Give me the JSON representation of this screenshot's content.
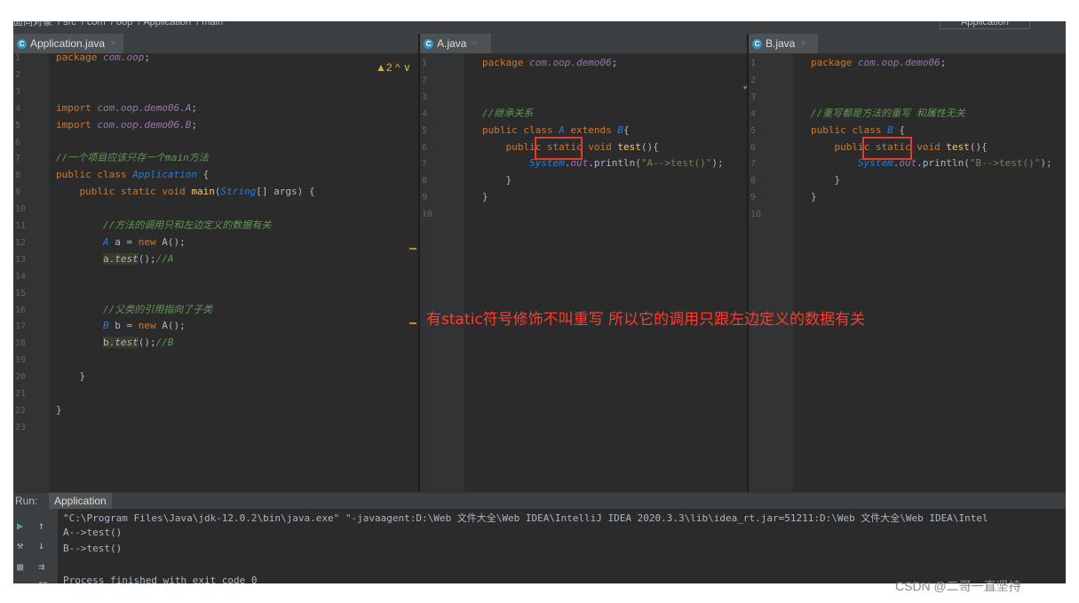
{
  "breadcrumbs": [
    "面向对象",
    "src",
    "com",
    "oop",
    "Application",
    "main"
  ],
  "run_config": "Application",
  "panes": {
    "application": {
      "tab": "Application.java",
      "warning": "▲2 ^ ∨",
      "lines": [
        {
          "n": "1",
          "html": "<span class='kw'>package </span><span class='pk'>com.oop</span>;"
        },
        {
          "n": "2",
          "html": ""
        },
        {
          "n": "3",
          "html": ""
        },
        {
          "n": "4",
          "html": "<span class='kw'>import </span><span class='pk'>com.oop.demo06.A</span>;"
        },
        {
          "n": "5",
          "html": "<span class='kw'>import </span><span class='pk'>com.oop.demo06.B</span>;"
        },
        {
          "n": "6",
          "html": ""
        },
        {
          "n": "7",
          "html": "<span class='cm'>//一个项目应该只存一个main方法</span>"
        },
        {
          "n": "8",
          "html": "<span class='kw'>public class </span><span class='cls'>Application</span> {"
        },
        {
          "n": "9",
          "html": "    <span class='kw'>public static void </span><span class='fn'>main</span>(<span class='cls'>String</span>[] args) {"
        },
        {
          "n": "10",
          "html": ""
        },
        {
          "n": "11",
          "html": "        <span class='cm'>//方法的调用只和左边定义的数据有关</span>"
        },
        {
          "n": "12",
          "html": "        <span class='cls'>A</span> a = <span class='kw'>new </span>A();"
        },
        {
          "n": "13",
          "html": "        <span class='hl'>a.<span class='it'>test</span></span>();<span class='cm'>//A</span>"
        },
        {
          "n": "14",
          "html": ""
        },
        {
          "n": "15",
          "html": ""
        },
        {
          "n": "16",
          "html": "        <span class='cm'>//父类的引用指向了子类</span>"
        },
        {
          "n": "17",
          "html": "        <span class='cls'>B</span> b = <span class='kw'>new </span>A();"
        },
        {
          "n": "18",
          "html": "        <span class='hl'>b.<span class='it'>test</span></span>();<span class='cm'>//B</span>"
        },
        {
          "n": "19",
          "html": ""
        },
        {
          "n": "20",
          "html": "    }"
        },
        {
          "n": "21",
          "html": ""
        },
        {
          "n": "22",
          "html": "}"
        },
        {
          "n": "23",
          "html": ""
        }
      ]
    },
    "a": {
      "tab": "A.java",
      "lines": [
        {
          "n": "1",
          "html": "<span class='kw'>package </span><span class='pk'>com.oop.demo06</span>;"
        },
        {
          "n": "2",
          "html": ""
        },
        {
          "n": "3",
          "html": ""
        },
        {
          "n": "4",
          "html": "<span class='cm'>//继承关系</span>"
        },
        {
          "n": "5",
          "html": "<span class='kw'>public class </span><span class='cls'>A </span><span class='kw'>extends </span><span class='cls'>B</span>{"
        },
        {
          "n": "6",
          "html": "    <span class='kw'>public static void </span><span class='fn'>test</span>(){"
        },
        {
          "n": "7",
          "html": "        <span class='cls'>System</span>.<span class='pk'>out</span>.println(<span class='str'>\"A-->test()\"</span>);"
        },
        {
          "n": "8",
          "html": "    }"
        },
        {
          "n": "9",
          "html": "}"
        },
        {
          "n": "10",
          "html": ""
        }
      ]
    },
    "b": {
      "tab": "B.java",
      "lines": [
        {
          "n": "1",
          "html": "<span class='kw'>package </span><span class='pk'>com.oop.demo06</span>;"
        },
        {
          "n": "2",
          "html": ""
        },
        {
          "n": "3",
          "html": ""
        },
        {
          "n": "4",
          "html": "<span class='cm'>//重写都是方法的重写 和属性无关</span>"
        },
        {
          "n": "5",
          "html": "<span class='kw'>public class </span><span class='cls'>B </span>{"
        },
        {
          "n": "6",
          "html": "    <span class='kw'>public static void </span><span class='fn'>test</span>(){"
        },
        {
          "n": "7",
          "html": "        <span class='cls'>System</span>.<span class='pk'>out</span>.println(<span class='str'>\"B-->test()\"</span>);"
        },
        {
          "n": "8",
          "html": "    }"
        },
        {
          "n": "9",
          "html": "}"
        },
        {
          "n": "10",
          "html": ""
        }
      ]
    }
  },
  "annotation": "有static符号修饰不叫重写  所以它的调用只跟左边定义的数据有关",
  "run": {
    "label": "Run:",
    "tab": "Application",
    "output": [
      "\"C:\\Program Files\\Java\\jdk-12.0.2\\bin\\java.exe\" \"-javaagent:D:\\Web 文件大全\\Web IDEA\\IntelliJ IDEA 2020.3.3\\lib\\idea_rt.jar=51211:D:\\Web 文件大全\\Web IDEA\\Intel",
      "A-->test()",
      "B-->test()",
      "",
      "Process finished with exit code 0"
    ]
  },
  "watermark": "CSDN @二哥一直坚持"
}
